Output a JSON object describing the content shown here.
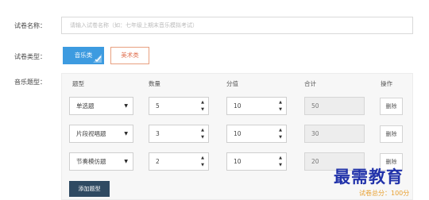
{
  "form": {
    "name_label": "试卷名称：",
    "name_placeholder": "请输入试卷名称（如：七年级上期末音乐模拟考试）",
    "type_label": "试卷类型：",
    "type_options": [
      "音乐类",
      "美术类"
    ],
    "type_selected": "音乐类",
    "music_label": "音乐题型："
  },
  "table": {
    "headers": [
      "题型",
      "数量",
      "分值",
      "合计",
      "操作"
    ],
    "rows": [
      {
        "type": "单选题",
        "quantity": "5",
        "score": "10",
        "total": "50",
        "action": "删除"
      },
      {
        "type": "片段视唱题",
        "quantity": "3",
        "score": "10",
        "total": "30",
        "action": "删除"
      },
      {
        "type": "节奏模仿题",
        "quantity": "2",
        "score": "10",
        "total": "20",
        "action": "删除"
      }
    ],
    "add_label": "添加题型",
    "total_text": "试卷总分：100分"
  },
  "watermark": "最需教育",
  "colors": {
    "accent": "#3d9be0",
    "art": "#e07050",
    "add_button": "#2f4a62",
    "total": "#e8a030",
    "watermark": "#2233aa"
  }
}
